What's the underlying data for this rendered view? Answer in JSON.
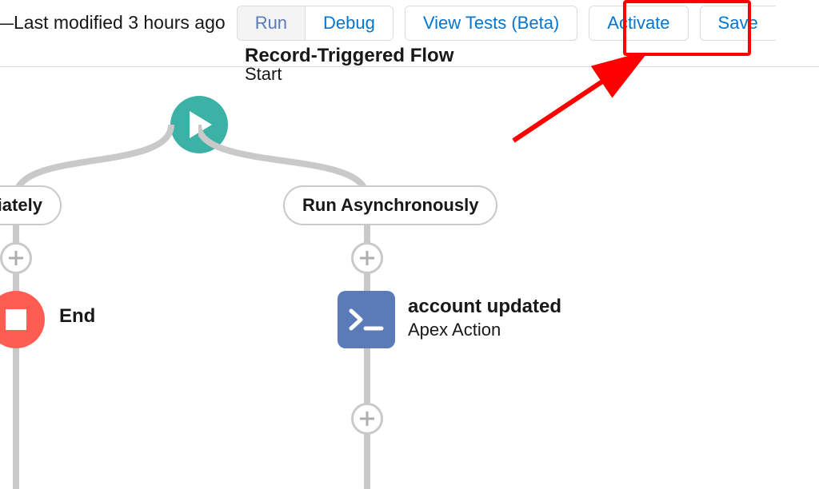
{
  "toolbar": {
    "status_prefix": "—Last modified ",
    "status_time": "3 hours ago",
    "run_label": "Run",
    "debug_label": "Debug",
    "view_tests_label": "View Tests (Beta)",
    "activate_label": "Activate",
    "save_label": "Save"
  },
  "start": {
    "title": "Record-Triggered Flow",
    "subtitle": "Start"
  },
  "branches": {
    "left": {
      "label": "nmediately"
    },
    "right": {
      "label": "Run Asynchronously"
    }
  },
  "end": {
    "label": "End"
  },
  "apex": {
    "title": "account updated",
    "subtitle": "Apex Action"
  },
  "icons": {
    "play": "play-icon",
    "stop": "stop-icon",
    "terminal": "terminal-icon",
    "plus": "plus-icon"
  },
  "colors": {
    "brand_link": "#0176d3",
    "start_node": "#3cb2a6",
    "end_node": "#ff5d52",
    "apex_node": "#5a7ab8",
    "connector": "#c9c9c9",
    "highlight": "#ff0000"
  }
}
